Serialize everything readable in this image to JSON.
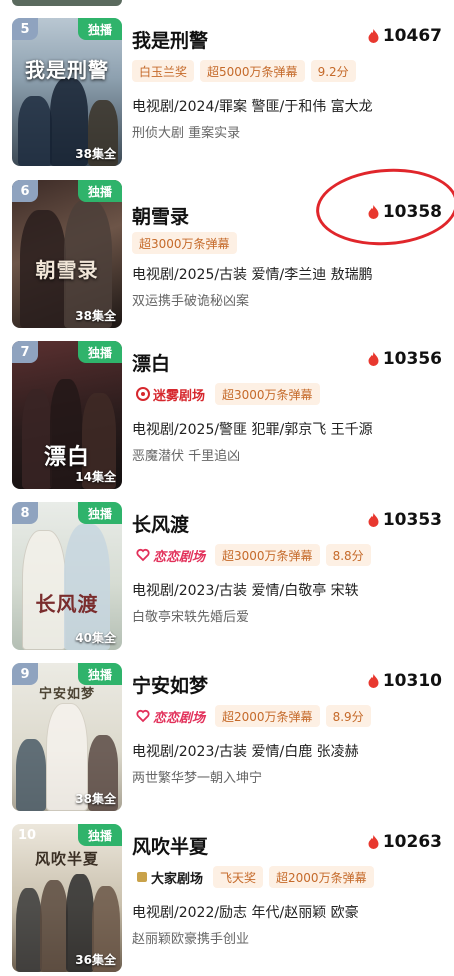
{
  "items": [
    {
      "rank": "5",
      "rank_color": "#8fa3bf",
      "exclusive": "独播",
      "episodes": "38集全",
      "poster_text": "我是刑警",
      "title": "我是刑警",
      "heat": "10467",
      "tags": [
        "白玉兰奖",
        "超5000万条弹幕",
        "9.2分"
      ],
      "meta": "电视剧/2024/罪案 警匪/于和伟 富大龙",
      "desc": "刑侦大剧 重案实录"
    },
    {
      "rank": "6",
      "rank_color": "#8fa3bf",
      "exclusive": "独播",
      "episodes": "38集全",
      "poster_text": "朝雪录",
      "title": "朝雪录",
      "heat": "10358",
      "tags": [
        "超3000万条弹幕"
      ],
      "meta": "电视剧/2025/古装 爱情/李兰迪 敖瑞鹏",
      "desc": "双运携手破诡秘凶案"
    },
    {
      "rank": "7",
      "rank_color": "#8fa3bf",
      "exclusive": "独播",
      "episodes": "14集全",
      "poster_text": "漂白",
      "title": "漂白",
      "heat": "10356",
      "brand": "迷雾剧场",
      "brand_color": "#d6282e",
      "tags": [
        "超3000万条弹幕"
      ],
      "meta": "电视剧/2025/警匪 犯罪/郭京飞 王千源",
      "desc": "恶魔潜伏 千里追凶"
    },
    {
      "rank": "8",
      "rank_color": "#8fa3bf",
      "exclusive": "独播",
      "episodes": "40集全",
      "poster_text": "长风渡",
      "title": "长风渡",
      "heat": "10353",
      "brand": "恋恋剧场",
      "brand_color": "#e2305a",
      "tags": [
        "超3000万条弹幕",
        "8.8分"
      ],
      "meta": "电视剧/2023/古装 爱情/白敬亭 宋轶",
      "desc": "白敬亭宋轶先婚后爱"
    },
    {
      "rank": "9",
      "rank_color": "#8fa3bf",
      "exclusive": "独播",
      "episodes": "38集全",
      "poster_text": "宁安如梦",
      "title": "宁安如梦",
      "heat": "10310",
      "brand": "恋恋剧场",
      "brand_color": "#e2305a",
      "tags": [
        "超2000万条弹幕",
        "8.9分"
      ],
      "meta": "电视剧/2023/古装 爱情/白鹿 张凌赫",
      "desc": "两世繁华梦一朝入坤宁"
    },
    {
      "rank": "10",
      "rank_color": "#8fa3bf",
      "exclusive": "独播",
      "episodes": "36集全",
      "poster_text": "风吹半夏",
      "title": "风吹半夏",
      "heat": "10263",
      "brand": "大家剧场",
      "brand_color": "#1a1a1a",
      "tags": [
        "飞天奖",
        "超2000万条弹幕"
      ],
      "meta": "电视剧/2022/励志 年代/赵丽颖 欧豪",
      "desc": "赵丽颖欧豪携手创业"
    }
  ],
  "colors": {
    "flame": "#e8382f",
    "tag_bg": "#fdf0e4",
    "tag_text": "#c56a2a",
    "exclusive_bg": "#2fb36b",
    "circle": "#e0262b"
  }
}
